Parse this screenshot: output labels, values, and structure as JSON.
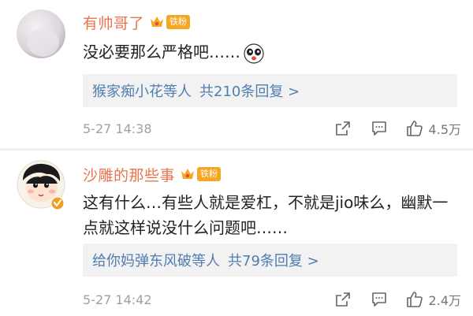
{
  "comments": [
    {
      "username": "有帅哥了",
      "badge": "铁粉",
      "text": "没必要那么严格吧……",
      "replies_users": "猴家痴小花等人",
      "replies_count": "共210条回复 >",
      "time": "5-27 14:38",
      "likes": "4.5万"
    },
    {
      "username": "沙雕的那些事",
      "badge": "铁粉",
      "text": "这有什么…有些人就是爱杠，不就是jio味么，幽默一点就这样说没什么问题吧……",
      "replies_users": "给你妈弹东风破等人",
      "replies_count": "共79条回复 >",
      "time": "5-27 14:42",
      "likes": "2.4万"
    }
  ],
  "colors": {
    "username": "#eb7350",
    "link": "#507daf",
    "badge": "#f5a623",
    "verified": "#f0a020"
  },
  "icons": [
    "crown-icon",
    "share-icon",
    "comment-icon",
    "like-icon",
    "emoji-icon",
    "verified-icon"
  ]
}
